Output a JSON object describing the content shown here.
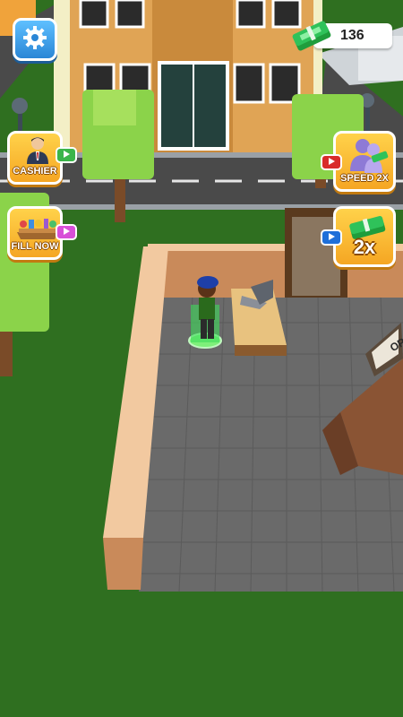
{
  "hud": {
    "cash_amount": "136",
    "settings_icon": "gear-icon"
  },
  "boosters": {
    "cashier_label": "CASHIER",
    "fill_now_label": "FILL NOW",
    "speed_label": "SPEED 2X",
    "multiplier_label": "2x"
  },
  "scene": {
    "sign_text": "OP"
  },
  "colors": {
    "settings_blue": "#2a86d6",
    "booster_yellow": "#f5a623",
    "ad_green": "#3bb54a",
    "ad_pink": "#d84fd8",
    "ad_red": "#d92b2b",
    "ad_blue": "#1e6fd9"
  }
}
